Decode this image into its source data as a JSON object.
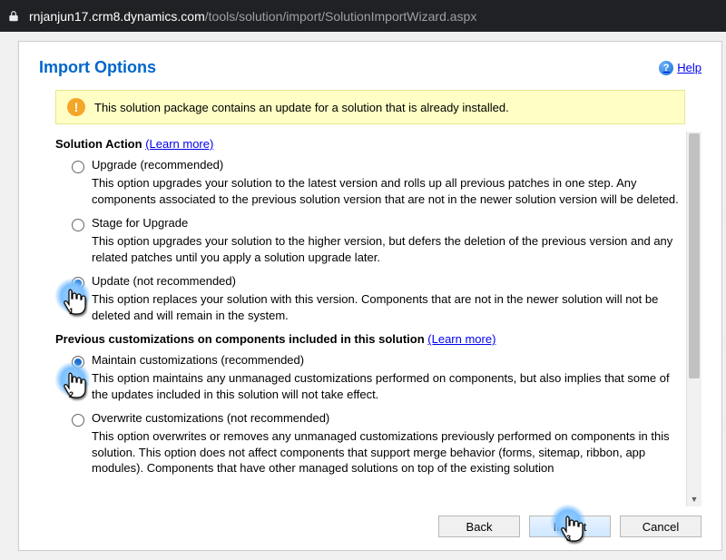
{
  "url": {
    "host": "rnjanjun17.crm8.dynamics.com",
    "path": "/tools/solution/import/SolutionImportWizard.aspx"
  },
  "dialog": {
    "title": "Import Options",
    "help_label": "Help"
  },
  "banner": {
    "text": "This solution package contains an update for a solution that is already installed."
  },
  "section_action": {
    "heading": "Solution Action",
    "learn_more": "(Learn more)",
    "options": [
      {
        "label": "Upgrade (recommended)",
        "desc": "This option upgrades your solution to the latest version and rolls up all previous patches in one step. Any components associated to the previous solution version that are not in the newer solution version will be deleted."
      },
      {
        "label": "Stage for Upgrade",
        "desc": "This option upgrades your solution to the higher version, but defers the deletion of the previous version and any related patches until you apply a solution upgrade later."
      },
      {
        "label": "Update (not recommended)",
        "desc": "This option replaces your solution with this version. Components that are not in the newer solution will not be deleted and will remain in the system."
      }
    ]
  },
  "section_cust": {
    "heading": "Previous customizations on components included in this solution",
    "learn_more": "(Learn more)",
    "options": [
      {
        "label": "Maintain customizations (recommended)",
        "desc": "This option maintains any unmanaged customizations performed on components, but also implies that some of the updates included in this solution will not take effect."
      },
      {
        "label": "Overwrite customizations (not recommended)",
        "desc": "This option overwrites or removes any unmanaged customizations previously performed on components in this solution. This option does not affect components that support merge behavior (forms, sitemap, ribbon, app modules). Components that have other managed solutions on top of the existing solution"
      }
    ]
  },
  "footer": {
    "back": "Back",
    "import": "Import",
    "cancel": "Cancel"
  }
}
